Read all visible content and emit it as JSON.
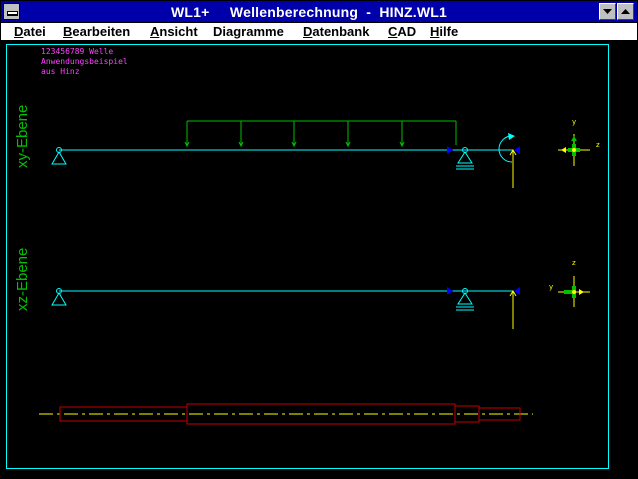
{
  "window": {
    "title": "WL1+     Wellenberechnung  -  HINZ.WL1"
  },
  "menu": [
    {
      "label": "Datei",
      "accel": "D",
      "rest": "atei"
    },
    {
      "label": "Bearbeiten",
      "accel": "B",
      "rest": "earbeiten"
    },
    {
      "label": "Ansicht",
      "accel": "A",
      "rest": "nsicht"
    },
    {
      "label": "Diagramme",
      "accel": "",
      "rest": "Diagramme"
    },
    {
      "label": "Datenbank",
      "accel": "D",
      "rest": "atenbank"
    },
    {
      "label": "CAD",
      "accel": "C",
      "rest": "AD"
    },
    {
      "label": "Hilfe",
      "accel": "H",
      "rest": "ilfe"
    }
  ],
  "info": {
    "line1": "123456789  Welle",
    "line2": "Anwendungsbeispiel",
    "line3": "aus Hinz"
  },
  "planes": {
    "xy": "xy-Ebene",
    "xz": "xz-Ebene"
  },
  "axes": {
    "xy_vertical": "y",
    "xy_horizontal": "z",
    "xz_vertical": "z",
    "xz_horizontal": "y"
  },
  "colors": {
    "background": "#000000",
    "shaft_line": "#00ffff",
    "load": "#00c000",
    "support": "#00ffff",
    "force": "#ffff00",
    "contour": "#c00000",
    "label": "#ff40ff",
    "titlebar": "#0000aa"
  }
}
